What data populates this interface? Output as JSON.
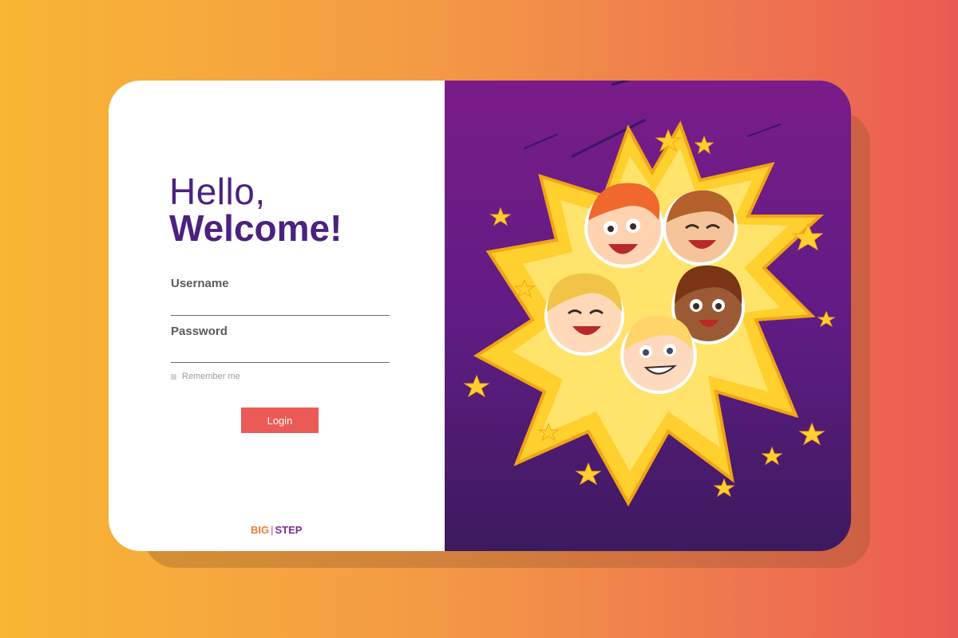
{
  "greeting": {
    "line1": "Hello,",
    "line2": "Welcome!"
  },
  "form": {
    "username_label": "Username",
    "username_value": "",
    "password_label": "Password",
    "password_value": "",
    "remember_label": "Remember me",
    "remember_checked": false,
    "login_label": "Login"
  },
  "brand": {
    "left": "BIG",
    "right": "STEP"
  },
  "colors": {
    "background_start": "#f8b634",
    "background_end": "#eb5a52",
    "accent": "#ec5a57",
    "title": "#4b2280",
    "panel_purple": "#7a1c8a"
  },
  "illustration": {
    "icon": "kids-cheering-burst-illustration"
  }
}
